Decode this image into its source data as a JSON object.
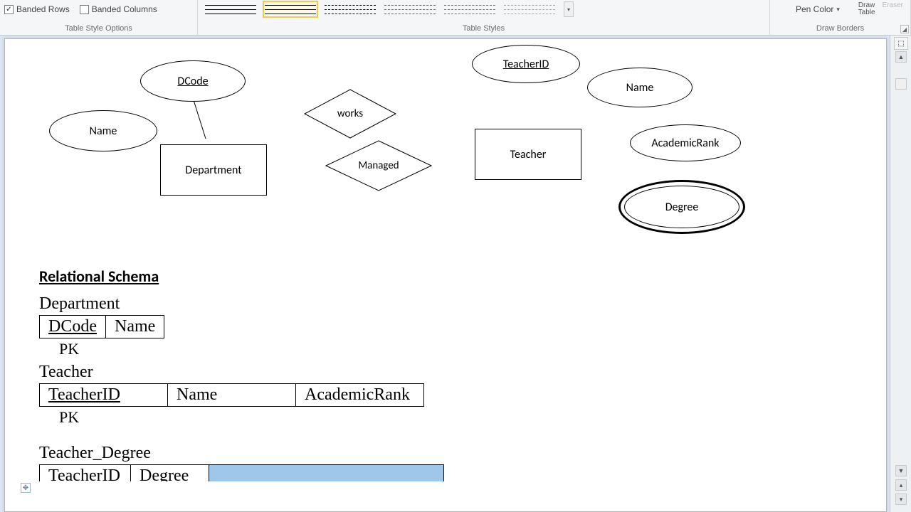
{
  "ribbon": {
    "banded_rows": "Banded Rows",
    "banded_columns": "Banded Columns",
    "group_style_options": "Table Style Options",
    "group_table_styles": "Table Styles",
    "pen_color": "Pen Color",
    "draw": "Draw",
    "table": "Table",
    "eraser": "Eraser",
    "group_draw_borders": "Draw Borders"
  },
  "er": {
    "dcode": "DCode",
    "name_left": "Name",
    "department": "Department",
    "works": "works",
    "managed": "Managed",
    "teacherid": "TeacherID",
    "teacher": "Teacher",
    "name_right": "Name",
    "academic_rank": "AcademicRank",
    "degree": "Degree"
  },
  "schema": {
    "title": "Relational Schema",
    "t1": {
      "name": "Department",
      "cols": [
        "DCode",
        "Name"
      ],
      "pk": "PK"
    },
    "t2": {
      "name": "Teacher",
      "cols": [
        "TeacherID",
        "Name",
        "AcademicRank"
      ],
      "pk": "PK"
    },
    "t3": {
      "name": "Teacher_Degree",
      "cols": [
        "TeacherID",
        "Degree",
        ""
      ]
    }
  }
}
